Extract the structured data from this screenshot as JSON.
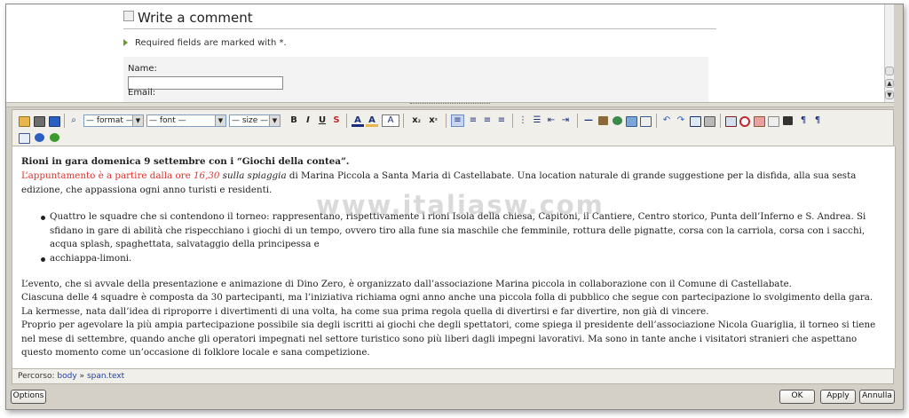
{
  "preview": {
    "comment_heading": "Write a comment",
    "required_note": "Required fields are marked with *.",
    "name_label": "Name:",
    "email_label": "Email:"
  },
  "toolbar": {
    "format_select": "— format —",
    "font_select": "— font —",
    "size_select": "— size —",
    "bold": "B",
    "italic": "I",
    "underline": "U",
    "strike": "S",
    "text_color": "A",
    "bg_color": "A",
    "subscript": "x",
    "subscript_mark": "₂",
    "superscript": "x",
    "superscript_mark": "²",
    "icons": [
      "open-folder-icon",
      "save-copy-icon",
      "import-icon",
      "find-icon",
      "bold-icon",
      "italic-icon",
      "underline-icon",
      "strikethrough-icon",
      "font-color-icon",
      "highlight-icon",
      "style-icon",
      "subscript-icon",
      "superscript-icon",
      "align-left-icon",
      "align-center-icon",
      "align-right-icon",
      "justify-icon",
      "ordered-list-icon",
      "unordered-list-icon",
      "outdent-icon",
      "indent-icon",
      "horizontal-rule-icon",
      "insert-object-icon",
      "link-icon",
      "image-icon",
      "table-icon",
      "undo-icon",
      "redo-icon",
      "grid-icon",
      "print-icon",
      "preview-icon",
      "spellcheck-icon",
      "eraser-icon",
      "format-icon",
      "insert-row-icon",
      "ltr-icon",
      "rtl-icon",
      "source-icon",
      "help-icon",
      "about-icon"
    ]
  },
  "editor": {
    "heading": "Rioni in gara domenica 9 settembre con i “Giochi della contea”.",
    "p1_red_a": "L’appuntamento è a partire dalla ore ",
    "p1_red_time": "16,30",
    "p1_italic": " sulla spiaggia",
    "p1_rest": " di Marina Piccola a Santa Maria di Castellabate. Una location naturale di grande suggestione per la disfida, alla sua sesta edizione, che appassiona ogni anno turisti e residenti.",
    "bullet1": "Quattro le squadre che si contendono il torneo: rappresentano, rispettivamente i rioni Isola della chiesa, Capitoni, il Cantiere, Centro storico, Punta dell’Inferno e S. Andrea. Si sfidano in gare di abilità che rispecchiano i giochi di un tempo, ovvero tiro alla fune sia maschile che femminile, rottura delle pignatte, corsa con la carriola, corsa con i sacchi, acqua splash, spaghettata, salvataggio della principessa e",
    "bullet2": "acchiappa-limoni.",
    "p2": "L’evento, che si avvale della presentazione e animazione di Dino Zero, è organizzato dall’associazione Marina piccola in collaborazione con il Comune di Castellabate.",
    "p3": "Ciascuna delle 4 squadre è composta da 30 partecipanti, ma l’iniziativa richiama ogni anno anche una piccola folla di pubblico che segue con partecipazione lo svolgimento della gara. La kermesse, nata dall’idea di riproporre i divertimenti di una volta, ha come sua prima regola quella di divertirsi e far divertire, non già di vincere.",
    "p4": "Proprio per agevolare la più ampia partecipazione possibile sia degli iscritti ai giochi che degli spettatori, come spiega il presidente dell’associazione Nicola Guariglia, il torneo si tiene nel mese di settembre, quando anche gli operatori impegnati nel settore turistico sono più liberi dagli impegni lavorativi. Ma sono in tante anche i visitatori stranieri che aspettano questo momento come un’occasione di folklore locale e sana competizione.",
    "watermark": "www.italiasw.com"
  },
  "path": {
    "label": "Percorso:",
    "crumb1": "body",
    "sep": "»",
    "crumb2": "span.text"
  },
  "buttons": {
    "options": "Options",
    "ok": "OK",
    "apply": "Apply",
    "cancel": "Annulla"
  },
  "colors": {
    "red_text": "#e0312a",
    "link_blue": "#1f3fa8",
    "toolbar_bg": "#f0efe9"
  }
}
